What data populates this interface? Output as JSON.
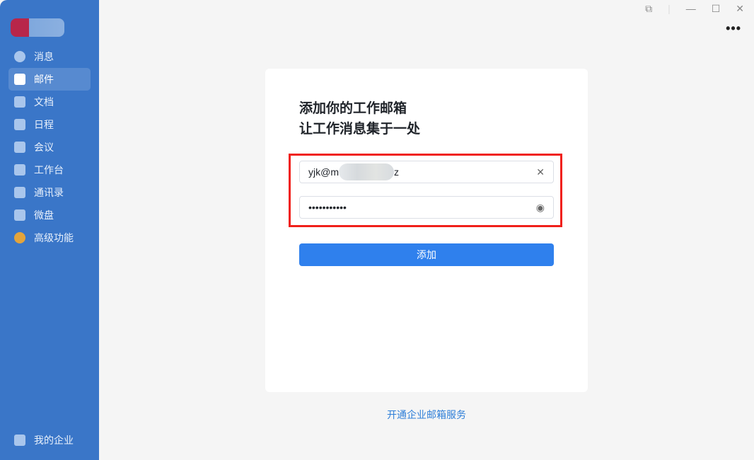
{
  "sidebar": {
    "items": [
      {
        "label": "消息",
        "icon": "chat-icon"
      },
      {
        "label": "邮件",
        "icon": "mail-icon",
        "active": true
      },
      {
        "label": "文档",
        "icon": "docs-icon"
      },
      {
        "label": "日程",
        "icon": "calendar-icon"
      },
      {
        "label": "会议",
        "icon": "meeting-icon"
      },
      {
        "label": "工作台",
        "icon": "workspace-icon"
      },
      {
        "label": "通讯录",
        "icon": "contacts-icon"
      },
      {
        "label": "微盘",
        "icon": "drive-icon"
      },
      {
        "label": "高级功能",
        "icon": "premium-icon"
      }
    ],
    "bottom": {
      "label": "我的企业",
      "icon": "company-icon"
    }
  },
  "window": {
    "more": "•••"
  },
  "card": {
    "title_line1": "添加你的工作邮箱",
    "title_line2": "让工作消息集于一处",
    "email_prefix": "yjk@m",
    "email_suffix": "z",
    "password": "•••••••••••",
    "add_label": "添加"
  },
  "colors": {
    "sidebar": "#3a76c8",
    "primary": "#2f80ed",
    "highlight": "#f0201a"
  },
  "footer": {
    "link": "开通企业邮箱服务"
  }
}
